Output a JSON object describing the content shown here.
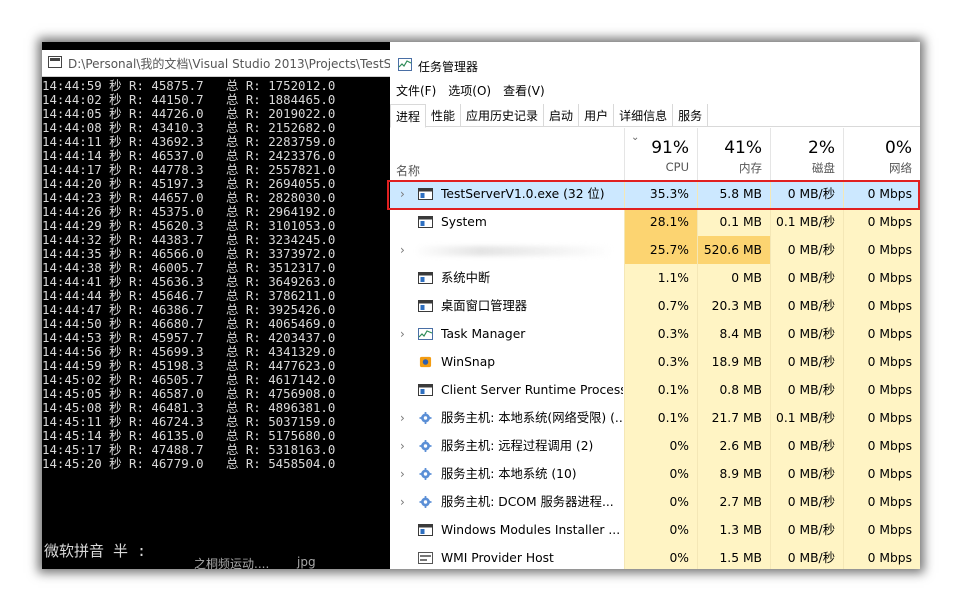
{
  "console": {
    "title": "D:\\Personal\\我的文档\\Visual Studio 2013\\Projects\\TestS",
    "lines": [
      "14:44:59 秒 R: 45875.7   总 R: 1752012.0",
      "14:44:02 秒 R: 44150.7   总 R: 1884465.0",
      "14:44:05 秒 R: 44726.0   总 R: 2019022.0",
      "14:44:08 秒 R: 43410.3   总 R: 2152682.0",
      "14:44:11 秒 R: 43692.3   总 R: 2283759.0",
      "14:44:14 秒 R: 46537.0   总 R: 2423376.0",
      "14:44:17 秒 R: 44778.3   总 R: 2557821.0",
      "14:44:20 秒 R: 45197.3   总 R: 2694055.0",
      "14:44:23 秒 R: 44657.0   总 R: 2828030.0",
      "14:44:26 秒 R: 45375.0   总 R: 2964192.0",
      "14:44:29 秒 R: 45620.3   总 R: 3101053.0",
      "14:44:32 秒 R: 44383.7   总 R: 3234245.0",
      "14:44:35 秒 R: 46566.0   总 R: 3373972.0",
      "14:44:38 秒 R: 46005.7   总 R: 3512317.0",
      "14:44:41 秒 R: 45636.3   总 R: 3649263.0",
      "14:44:44 秒 R: 45646.7   总 R: 3786211.0",
      "14:44:47 秒 R: 46386.7   总 R: 3925426.0",
      "14:44:50 秒 R: 46680.7   总 R: 4065469.0",
      "14:44:53 秒 R: 45957.7   总 R: 4203437.0",
      "14:44:56 秒 R: 45699.3   总 R: 4341329.0",
      "14:44:59 秒 R: 45198.3   总 R: 4477623.0",
      "14:45:02 秒 R: 46505.7   总 R: 4617142.0",
      "14:45:05 秒 R: 46587.0   总 R: 4756908.0",
      "14:45:08 秒 R: 46481.3   总 R: 4896381.0",
      "14:45:11 秒 R: 46724.3   总 R: 5037159.0",
      "14:45:14 秒 R: 46135.0   总 R: 5175680.0",
      "14:45:17 秒 R: 47488.7   总 R: 5318163.0",
      "14:45:20 秒 R: 46779.0   总 R: 5458504.0"
    ],
    "ime_text": "微软拼音 半 :",
    "ghost_text": "之桐频运动....",
    "ghost_text2": "jpg"
  },
  "taskmgr": {
    "title": "任务管理器",
    "menu": [
      "文件(F)",
      "选项(O)",
      "查看(V)"
    ],
    "tabs": [
      "进程",
      "性能",
      "应用历史记录",
      "启动",
      "用户",
      "详细信息",
      "服务"
    ],
    "header": {
      "name_label": "名称",
      "cpu_pct": "91%",
      "cpu_label": "CPU",
      "mem_pct": "41%",
      "mem_label": "内存",
      "disk_pct": "2%",
      "disk_label": "磁盘",
      "net_pct": "0%",
      "net_label": "网络"
    },
    "rows": [
      {
        "name": "TestServerV1.0.exe (32 位)",
        "cpu": "35.3%",
        "mem": "5.8 MB",
        "disk": "0 MB/秒",
        "net": "0 Mbps",
        "expand": true,
        "icon": "app-window-icon"
      },
      {
        "name": "System",
        "cpu": "28.1%",
        "mem": "0.1 MB",
        "disk": "0.1 MB/秒",
        "net": "0 Mbps",
        "expand": false,
        "icon": "app-window-icon"
      },
      {
        "name": "",
        "cpu": "25.7%",
        "mem": "520.6 MB",
        "disk": "0 MB/秒",
        "net": "0 Mbps",
        "expand": true,
        "icon": "",
        "blurred": true
      },
      {
        "name": "系统中断",
        "cpu": "1.1%",
        "mem": "0 MB",
        "disk": "0 MB/秒",
        "net": "0 Mbps",
        "expand": false,
        "icon": "app-window-icon"
      },
      {
        "name": "桌面窗口管理器",
        "cpu": "0.7%",
        "mem": "20.3 MB",
        "disk": "0 MB/秒",
        "net": "0 Mbps",
        "expand": false,
        "icon": "app-window-icon"
      },
      {
        "name": "Task Manager",
        "cpu": "0.3%",
        "mem": "8.4 MB",
        "disk": "0 MB/秒",
        "net": "0 Mbps",
        "expand": true,
        "icon": "task-manager-icon"
      },
      {
        "name": "WinSnap",
        "cpu": "0.3%",
        "mem": "18.9 MB",
        "disk": "0 MB/秒",
        "net": "0 Mbps",
        "expand": false,
        "icon": "winsnap-icon"
      },
      {
        "name": "Client Server Runtime Process",
        "cpu": "0.1%",
        "mem": "0.8 MB",
        "disk": "0 MB/秒",
        "net": "0 Mbps",
        "expand": false,
        "icon": "app-window-icon"
      },
      {
        "name": "服务主机: 本地系统(网络受限) (...",
        "cpu": "0.1%",
        "mem": "21.7 MB",
        "disk": "0.1 MB/秒",
        "net": "0 Mbps",
        "expand": true,
        "icon": "gear-icon"
      },
      {
        "name": "服务主机: 远程过程调用 (2)",
        "cpu": "0%",
        "mem": "2.6 MB",
        "disk": "0 MB/秒",
        "net": "0 Mbps",
        "expand": true,
        "icon": "gear-icon"
      },
      {
        "name": "服务主机: 本地系统 (10)",
        "cpu": "0%",
        "mem": "8.9 MB",
        "disk": "0 MB/秒",
        "net": "0 Mbps",
        "expand": true,
        "icon": "gear-icon"
      },
      {
        "name": "服务主机: DCOM 服务器进程...",
        "cpu": "0%",
        "mem": "2.7 MB",
        "disk": "0 MB/秒",
        "net": "0 Mbps",
        "expand": true,
        "icon": "gear-icon"
      },
      {
        "name": "Windows Modules Installer ...",
        "cpu": "0%",
        "mem": "1.3 MB",
        "disk": "0 MB/秒",
        "net": "0 Mbps",
        "expand": false,
        "icon": "app-window-icon"
      },
      {
        "name": "WMI Provider Host",
        "cpu": "0%",
        "mem": "1.5 MB",
        "disk": "0 MB/秒",
        "net": "0 Mbps",
        "expand": false,
        "icon": "wmi-icon"
      }
    ],
    "heat_colors": {
      "cpu": [
        "#fcd471",
        "#fcd471",
        "#fcd471",
        "#fff4c4",
        "#fff4c4",
        "#fff4c4",
        "#fff4c4",
        "#fff4c4",
        "#fff4c4",
        "#fff4c4",
        "#fff4c4",
        "#fff4c4",
        "#fff4c4",
        "#fff4c4"
      ],
      "mem": [
        "#fff4c4",
        "#fff4c4",
        "#fcd471",
        "#fff4c4",
        "#fff4c4",
        "#fff4c4",
        "#fff4c4",
        "#fff4c4",
        "#fff4c4",
        "#fff4c4",
        "#fff4c4",
        "#fff4c4",
        "#fff4c4",
        "#fff4c4"
      ],
      "disk": [
        "#fff4c4",
        "#fff4c4",
        "#fff4c4",
        "#fff4c4",
        "#fff4c4",
        "#fff4c4",
        "#fff4c4",
        "#fff4c4",
        "#fff4c4",
        "#fff4c4",
        "#fff4c4",
        "#fff4c4",
        "#fff4c4",
        "#fff4c4"
      ],
      "net": [
        "#fff4c4",
        "#fff4c4",
        "#fff4c4",
        "#fff4c4",
        "#fff4c4",
        "#fff4c4",
        "#fff4c4",
        "#fff4c4",
        "#fff4c4",
        "#fff4c4",
        "#fff4c4",
        "#fff4c4",
        "#fff4c4",
        "#fff4c4"
      ]
    },
    "selected_row_color": "#cce8ff",
    "highlight_color": "#e02020"
  }
}
